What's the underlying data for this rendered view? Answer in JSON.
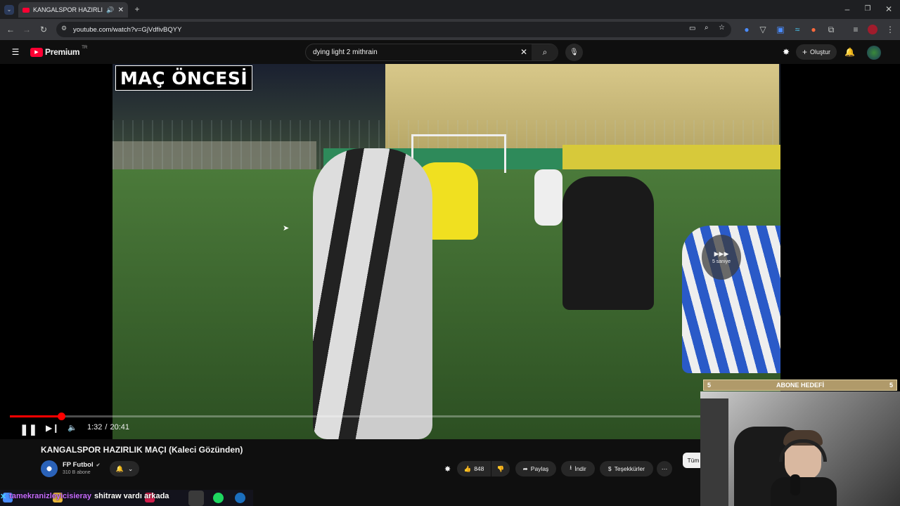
{
  "browser": {
    "tab_title": "KANGALSPOR HAZIRLIK MA",
    "url": "youtube.com/watch?v=GjVdfivBQYY"
  },
  "youtube": {
    "logo_text": "Premium",
    "region": "TR",
    "search_value": "dying light 2 mithrain",
    "create_label": "Oluştur"
  },
  "video": {
    "overlay_text": "MAÇ ÖNCESİ",
    "skip_label": "5 saniye",
    "time_current": "1:32",
    "time_sep": "/",
    "time_total": "20:41",
    "progress_fraction": 0.074
  },
  "info": {
    "title": "KANGALSPOR HAZIRLIK MAÇI (Kaleci Gözünden)",
    "channel": "FP Futbol",
    "subscribers": "310 B abone",
    "likes": "848",
    "share_label": "Paylaş",
    "download_label": "İndir",
    "thanks_label": "Teşekkürler",
    "chip_label": "Tüm"
  },
  "overlay": {
    "goal_left": "5",
    "goal_label": "ABONE HEDEFİ",
    "goal_right": "5",
    "chat_user": "tamekranizleyicisieray",
    "chat_text": "shitraw vardı arkada"
  }
}
